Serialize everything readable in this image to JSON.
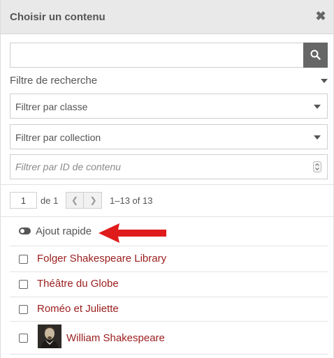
{
  "header": {
    "title": "Choisir un contenu"
  },
  "search": {
    "value": ""
  },
  "filters": {
    "heading": "Filtre de recherche",
    "class_select": "Filtrer par classe",
    "collection_select": "Filtrer par collection",
    "id_placeholder": "Filtrer par ID de contenu"
  },
  "pagination": {
    "current_page": "1",
    "of_label": "de 1",
    "range": "1–13 of 13"
  },
  "quick_add": {
    "label": "Ajout rapide"
  },
  "annotation": {
    "arrow_color": "#e01b1b"
  },
  "items": [
    {
      "label": "Folger Shakespeare Library",
      "has_thumbnail": false
    },
    {
      "label": "Théâtre du Globe",
      "has_thumbnail": false
    },
    {
      "label": "Roméo et Juliette",
      "has_thumbnail": false
    },
    {
      "label": "William Shakespeare",
      "has_thumbnail": true
    }
  ],
  "colors": {
    "link": "#9b1c1c",
    "header_bg": "#e9e9e9",
    "search_button": "#666666"
  }
}
